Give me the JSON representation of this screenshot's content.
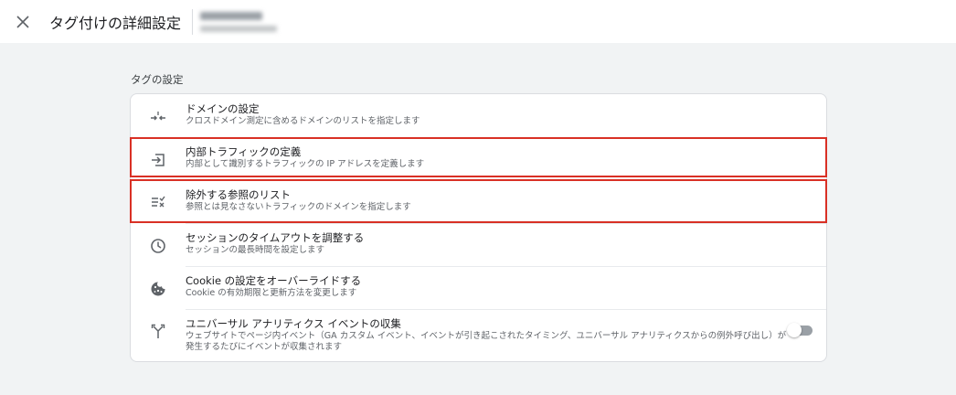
{
  "header": {
    "title": "タグ付けの詳細設定",
    "close_icon": "close-icon"
  },
  "section": {
    "label": "タグの設定"
  },
  "settings": [
    {
      "title": "ドメインの設定",
      "description": "クロスドメイン測定に含めるドメインのリストを指定します",
      "icon": "merge-arrows-icon"
    },
    {
      "title": "内部トラフィックの定義",
      "description": "内部として識別するトラフィックの IP アドレスを定義します",
      "icon": "login-arrow-icon"
    },
    {
      "title": "除外する参照のリスト",
      "description": "参照とは見なさないトラフィックのドメインを指定します",
      "icon": "list-exclude-icon"
    },
    {
      "title": "セッションのタイムアウトを調整する",
      "description": "セッションの最長時間を設定します",
      "icon": "clock-icon"
    },
    {
      "title": "Cookie の設定をオーバーライドする",
      "description": "Cookie の有効期限と更新方法を変更します",
      "icon": "cookie-icon"
    },
    {
      "title": "ユニバーサル アナリティクス イベントの収集",
      "description": "ウェブサイトでページ内イベント（GA カスタム イベント、イベントが引き起こされたタイミング、ユニバーサル アナリティクスからの例外呼び出し）が発生するたびにイベントが収集されます",
      "icon": "fork-icon",
      "toggle_on": false
    }
  ],
  "colors": {
    "highlight": "#d93025",
    "background": "#f1f3f4",
    "icon": "#5f6368"
  }
}
